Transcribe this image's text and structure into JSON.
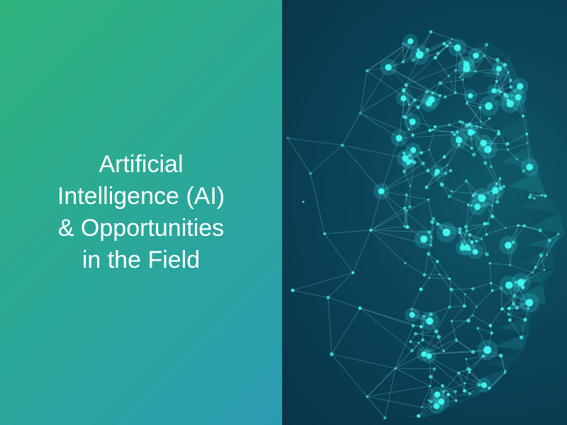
{
  "hero": {
    "title_lines": [
      "Artificial",
      "Intelligence (AI)",
      "& Opportunities",
      "in the Field"
    ]
  },
  "illustration": {
    "subject": "ai-head-network-graphic",
    "node_color": "#3ff3f0",
    "line_color": "#7fe9ef"
  },
  "colors": {
    "left_gradient_start": "#2fb37c",
    "left_gradient_end": "#2a9cb2",
    "right_background": "#0b4458",
    "text": "#ffffff"
  }
}
